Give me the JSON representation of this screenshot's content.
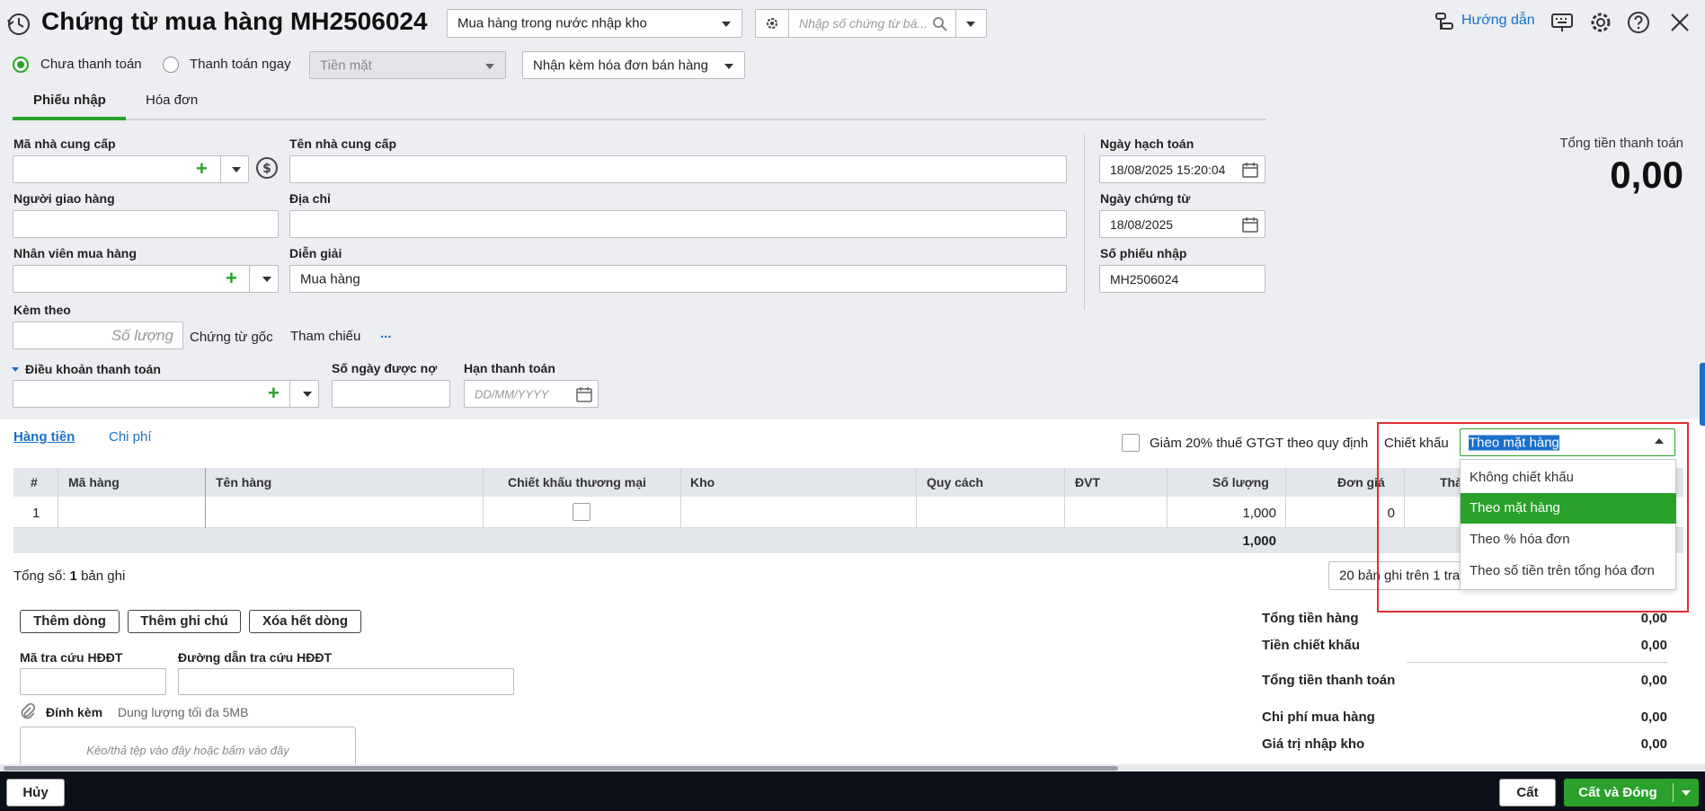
{
  "header": {
    "title": "Chứng từ mua hàng MH2506024",
    "voucher_type": "Mua hàng trong nước nhập kho",
    "search_placeholder": "Nhập số chứng từ bá...",
    "help_label": "Hướng dẫn"
  },
  "payment": {
    "unpaid_label": "Chưa thanh toán",
    "pay_now_label": "Thanh toán ngay",
    "method_value": "Tiền mặt",
    "invoice_option": "Nhận kèm hóa đơn bán hàng"
  },
  "tabs": {
    "receipt": "Phiếu nhập",
    "invoice": "Hóa đơn"
  },
  "form": {
    "supplier_code_label": "Mã nhà cung cấp",
    "supplier_name_label": "Tên nhà cung cấp",
    "deliverer_label": "Người giao hàng",
    "address_label": "Địa chỉ",
    "purchaser_label": "Nhân viên mua hàng",
    "description_label": "Diễn giải",
    "description_value": "Mua hàng",
    "attach_label": "Kèm theo",
    "quantity_placeholder": "Số lượng",
    "original_doc_label": "Chứng từ gốc",
    "reference_label": "Tham chiếu",
    "reference_more": "...",
    "terms_label": "Điều khoản thanh toán",
    "credit_days_label": "Số ngày được nợ",
    "due_date_label": "Hạn thanh toán",
    "due_date_placeholder": "DD/MM/YYYY",
    "posting_date_label": "Ngày hạch toán",
    "posting_date_value": "18/08/2025 15:20:04",
    "voucher_date_label": "Ngày chứng từ",
    "voucher_date_value": "18/08/2025",
    "receipt_no_label": "Số phiếu nhập",
    "receipt_no_value": "MH2506024"
  },
  "total": {
    "label": "Tổng tiền thanh toán",
    "value": "0,00"
  },
  "grid": {
    "tab_goods": "Hàng tiền",
    "tab_costs": "Chi phí",
    "vat_reduction_label": "Giảm 20% thuế GTGT theo quy định",
    "discount_label": "Chiết khấu",
    "discount_value": "Theo mặt hàng",
    "discount_options": [
      "Không chiết khấu",
      "Theo mặt hàng",
      "Theo % hóa đơn",
      "Theo số tiền trên tổng hóa đơn"
    ],
    "columns": [
      "#",
      "Mã hàng",
      "Tên hàng",
      "Chiết khấu thương mại",
      "Kho",
      "Quy cách",
      "ĐVT",
      "Số lượng",
      "Đơn giá",
      "Thà"
    ],
    "rows": [
      {
        "no": "1",
        "quantity": "1,000",
        "unit_price": "0"
      }
    ],
    "footer_quantity": "1,000",
    "record_count_prefix": "Tổng số:",
    "record_count": "1",
    "record_count_suffix": "bản ghi",
    "pager": "20 bản ghi trên 1 tra"
  },
  "actions": {
    "add_row": "Thêm dòng",
    "add_note": "Thêm ghi chú",
    "delete_all": "Xóa hết dòng"
  },
  "einvoice": {
    "lookup_code_label": "Mã tra cứu HĐĐT",
    "lookup_url_label": "Đường dẫn tra cứu HĐĐT",
    "attachment_label": "Đính kèm",
    "attachment_hint": "Dung lượng tối đa 5MB",
    "drop_hint": "Kéo/thả tệp vào đây hoặc bấm vào đây"
  },
  "summary": [
    {
      "label": "Tổng tiền hàng",
      "value": "0,00"
    },
    {
      "label": "Tiền chiết khấu",
      "value": "0,00"
    },
    {
      "label": "Tổng tiền thanh toán",
      "value": "0,00"
    },
    {
      "label": "Chi phí mua hàng",
      "value": "0,00"
    },
    {
      "label": "Giá trị nhập kho",
      "value": "0,00"
    }
  ],
  "footer": {
    "cancel": "Hủy",
    "save": "Cất",
    "save_close": "Cất và Đóng"
  },
  "colors": {
    "accent": "#2aa12a",
    "link": "#1a6fc9",
    "highlight": "#e03030"
  }
}
